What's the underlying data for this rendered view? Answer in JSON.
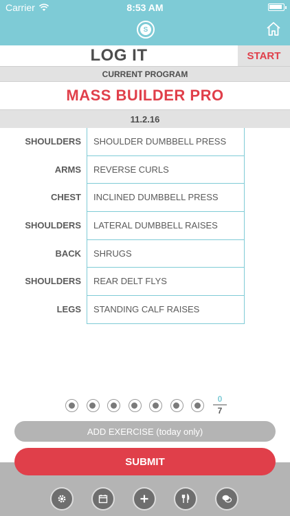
{
  "status_bar": {
    "carrier": "Carrier",
    "time": "8:53 AM"
  },
  "header": {
    "logo_letter": "S"
  },
  "logit": {
    "title": "LOG IT",
    "start_label": "START"
  },
  "program": {
    "section_label": "CURRENT PROGRAM",
    "name": "MASS BUILDER PRO",
    "date": "11.2.16"
  },
  "exercises": [
    {
      "category": "SHOULDERS",
      "name": "SHOULDER DUMBBELL PRESS"
    },
    {
      "category": "ARMS",
      "name": "REVERSE CURLS"
    },
    {
      "category": "CHEST",
      "name": "INCLINED DUMBBELL PRESS"
    },
    {
      "category": "SHOULDERS",
      "name": "LATERAL DUMBBELL RAISES"
    },
    {
      "category": "BACK",
      "name": "SHRUGS"
    },
    {
      "category": "SHOULDERS",
      "name": "REAR DELT FLYS"
    },
    {
      "category": "LEGS",
      "name": "STANDING CALF RAISES"
    }
  ],
  "progress": {
    "completed": "0",
    "total": "7"
  },
  "actions": {
    "add_exercise_label": "ADD EXERCISE (today only)",
    "submit_label": "SUBMIT"
  },
  "toolbar": {
    "icons": [
      "gear-icon",
      "calendar-icon",
      "plus-icon",
      "fork-knife-icon",
      "chat-icon"
    ]
  },
  "colors": {
    "accent": "#7ecbd6",
    "brand_red": "#e03f4a",
    "gray": "#b4b4b4"
  }
}
